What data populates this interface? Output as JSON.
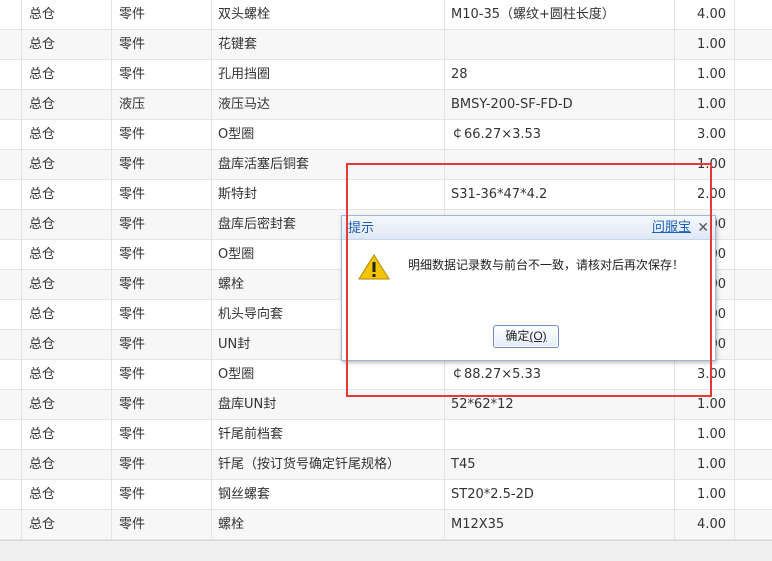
{
  "grid": {
    "rows": [
      {
        "warehouse": "总仓",
        "category": "零件",
        "name": "双头螺栓",
        "spec": "M10-35（螺纹+圆柱长度）",
        "qty": "4.00"
      },
      {
        "warehouse": "总仓",
        "category": "零件",
        "name": "花键套",
        "spec": "",
        "qty": "1.00"
      },
      {
        "warehouse": "总仓",
        "category": "零件",
        "name": "孔用挡圈",
        "spec": "28",
        "qty": "1.00"
      },
      {
        "warehouse": "总仓",
        "category": "液压",
        "name": "液压马达",
        "spec": "BMSY-200-SF-FD-D",
        "qty": "1.00"
      },
      {
        "warehouse": "总仓",
        "category": "零件",
        "name": "O型圈",
        "spec": "￠66.27×3.53",
        "qty": "3.00"
      },
      {
        "warehouse": "总仓",
        "category": "零件",
        "name": "盘库活塞后铜套",
        "spec": "",
        "qty": "1.00"
      },
      {
        "warehouse": "总仓",
        "category": "零件",
        "name": "斯特封",
        "spec": "S31-36*47*4.2",
        "qty": "2.00"
      },
      {
        "warehouse": "总仓",
        "category": "零件",
        "name": "盘库后密封套",
        "spec": "",
        "qty": "1.00"
      },
      {
        "warehouse": "总仓",
        "category": "零件",
        "name": "O型圈",
        "spec": "",
        "qty": "1.00"
      },
      {
        "warehouse": "总仓",
        "category": "零件",
        "name": "螺栓",
        "spec": "",
        "qty": "1.00"
      },
      {
        "warehouse": "总仓",
        "category": "零件",
        "name": "机头导向套",
        "spec": "",
        "qty": "1.00"
      },
      {
        "warehouse": "总仓",
        "category": "零件",
        "name": "UN封",
        "spec": "",
        "qty": "1.00"
      },
      {
        "warehouse": "总仓",
        "category": "零件",
        "name": "O型圈",
        "spec": "￠88.27×5.33",
        "qty": "3.00"
      },
      {
        "warehouse": "总仓",
        "category": "零件",
        "name": "盘库UN封",
        "spec": "52*62*12",
        "qty": "1.00"
      },
      {
        "warehouse": "总仓",
        "category": "零件",
        "name": "钎尾前档套",
        "spec": "",
        "qty": "1.00"
      },
      {
        "warehouse": "总仓",
        "category": "零件",
        "name": "钎尾（按订货号确定钎尾规格）",
        "spec": "T45",
        "qty": "1.00"
      },
      {
        "warehouse": "总仓",
        "category": "零件",
        "name": "钢丝螺套",
        "spec": "ST20*2.5-2D",
        "qty": "1.00"
      },
      {
        "warehouse": "总仓",
        "category": "零件",
        "name": "螺栓",
        "spec": "M12X35",
        "qty": "4.00"
      }
    ]
  },
  "dialog": {
    "title": "提示",
    "help_link": "问服宝",
    "close_glyph": "✕",
    "message": "明细数据记录数与前台不一致，请核对后再次保存！",
    "ok_label": "确定",
    "ok_accesskey": "(O)",
    "warning_icon": "warning-triangle-icon"
  },
  "colors": {
    "highlight_border": "#e53935",
    "link": "#1a5fb4",
    "warning_fill": "#f5c400"
  }
}
